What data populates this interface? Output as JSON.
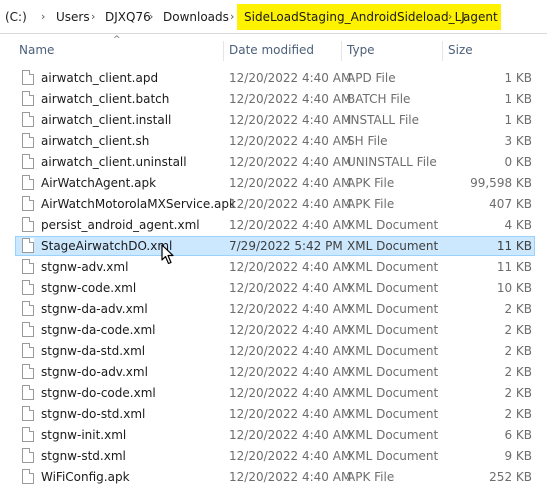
{
  "breadcrumb": {
    "items": [
      "(C:)",
      "Users",
      "DJXQ76",
      "Downloads",
      "SideLoadStaging_AndroidSideload_LJ",
      "agent"
    ]
  },
  "highlight_color": "#fff200",
  "columns": {
    "name": "Name",
    "date": "Date modified",
    "type": "Type",
    "size": "Size"
  },
  "files": [
    {
      "name": "airwatch_client.apd",
      "date": "12/20/2022 4:40 AM",
      "type": "APD File",
      "size": "1 KB"
    },
    {
      "name": "airwatch_client.batch",
      "date": "12/20/2022 4:40 AM",
      "type": "BATCH File",
      "size": "1 KB"
    },
    {
      "name": "airwatch_client.install",
      "date": "12/20/2022 4:40 AM",
      "type": "INSTALL File",
      "size": "1 KB"
    },
    {
      "name": "airwatch_client.sh",
      "date": "12/20/2022 4:40 AM",
      "type": "SH File",
      "size": "3 KB"
    },
    {
      "name": "airwatch_client.uninstall",
      "date": "12/20/2022 4:40 AM",
      "type": "UNINSTALL File",
      "size": "0 KB"
    },
    {
      "name": "AirWatchAgent.apk",
      "date": "12/20/2022 4:40 AM",
      "type": "APK File",
      "size": "99,598 KB"
    },
    {
      "name": "AirWatchMotorolaMXService.apk",
      "date": "12/20/2022 4:40 AM",
      "type": "APK File",
      "size": "407 KB"
    },
    {
      "name": "persist_android_agent.xml",
      "date": "12/20/2022 4:40 AM",
      "type": "XML Document",
      "size": "4 KB"
    },
    {
      "name": "StageAirwatchDO.xml",
      "date": "7/29/2022 5:42 PM",
      "type": "XML Document",
      "size": "11 KB",
      "selected": true
    },
    {
      "name": "stgnw-adv.xml",
      "date": "12/20/2022 4:40 AM",
      "type": "XML Document",
      "size": "11 KB"
    },
    {
      "name": "stgnw-code.xml",
      "date": "12/20/2022 4:40 AM",
      "type": "XML Document",
      "size": "10 KB"
    },
    {
      "name": "stgnw-da-adv.xml",
      "date": "12/20/2022 4:40 AM",
      "type": "XML Document",
      "size": "2 KB"
    },
    {
      "name": "stgnw-da-code.xml",
      "date": "12/20/2022 4:40 AM",
      "type": "XML Document",
      "size": "2 KB"
    },
    {
      "name": "stgnw-da-std.xml",
      "date": "12/20/2022 4:40 AM",
      "type": "XML Document",
      "size": "2 KB"
    },
    {
      "name": "stgnw-do-adv.xml",
      "date": "12/20/2022 4:40 AM",
      "type": "XML Document",
      "size": "2 KB"
    },
    {
      "name": "stgnw-do-code.xml",
      "date": "12/20/2022 4:40 AM",
      "type": "XML Document",
      "size": "2 KB"
    },
    {
      "name": "stgnw-do-std.xml",
      "date": "12/20/2022 4:40 AM",
      "type": "XML Document",
      "size": "2 KB"
    },
    {
      "name": "stgnw-init.xml",
      "date": "12/20/2022 4:40 AM",
      "type": "XML Document",
      "size": "6 KB"
    },
    {
      "name": "stgnw-std.xml",
      "date": "12/20/2022 4:40 AM",
      "type": "XML Document",
      "size": "9 KB"
    },
    {
      "name": "WiFiConfig.apk",
      "date": "12/20/2022 4:40 AM",
      "type": "APK File",
      "size": "252 KB"
    }
  ]
}
